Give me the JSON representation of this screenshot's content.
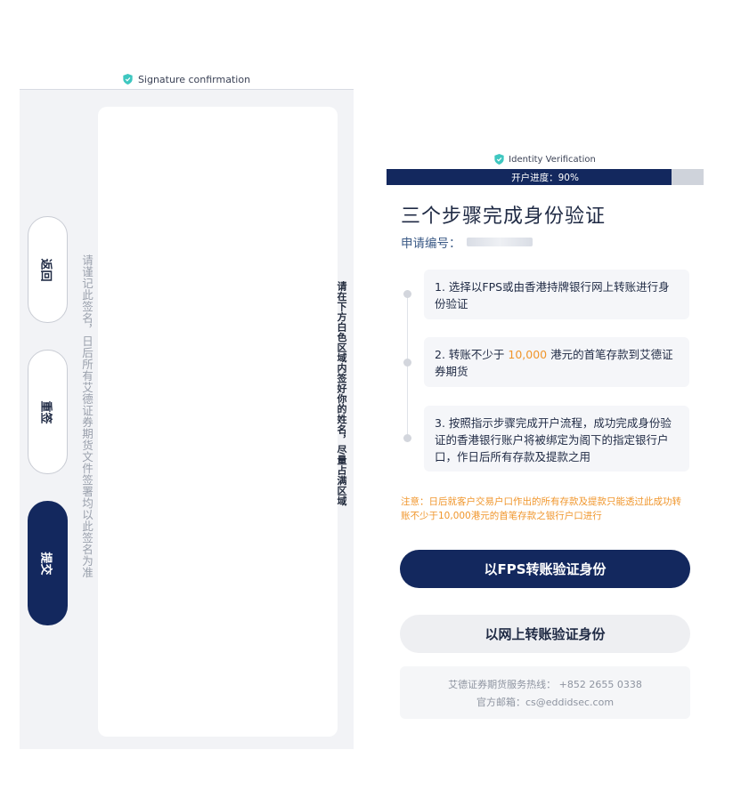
{
  "signature_screen": {
    "header_title": "Signature confirmation",
    "buttons": {
      "back": "返回",
      "resign": "重签",
      "submit": "提交"
    },
    "note": "请谨记此签名，日后所有艾德证券期货文件签署均以此签名为准",
    "instruction": "请在下方白色区域内签好你的姓名，尽量占满区域"
  },
  "verification_screen": {
    "header_title": "Identity Verification",
    "progress": {
      "label": "开户进度：90%",
      "percent": 90
    },
    "title": "三个步骤完成身份验证",
    "application_label": "申请编号：",
    "steps": [
      {
        "text": "1. 选择以FPS或由香港持牌银行网上转账进行身份验证"
      },
      {
        "text_before": "2. 转账不少于 ",
        "amount": "10,000",
        "text_after": " 港元的首笔存款到艾德证券期货"
      },
      {
        "text": "3. 按照指示步骤完成开户流程，成功完成身份验证的香港银行账户将被绑定为阁下的指定银行户口，作日后所有存款及提款之用"
      }
    ],
    "notice": "注意：日后就客户交易户口作出的所有存款及提款只能透过此成功转账不少于10,000港元的首笔存款之银行户口进行",
    "primary_button": "以FPS转账验证身份",
    "secondary_button": "以网上转账验证身份",
    "contact": {
      "hotline": "艾德证券期货服务热线：  +852 2655 0338",
      "email": "官方邮箱：cs@eddidsec.com"
    }
  },
  "colors": {
    "primary": "#13285e",
    "accent": "#f0962c",
    "shield": "#3ec7c0"
  }
}
